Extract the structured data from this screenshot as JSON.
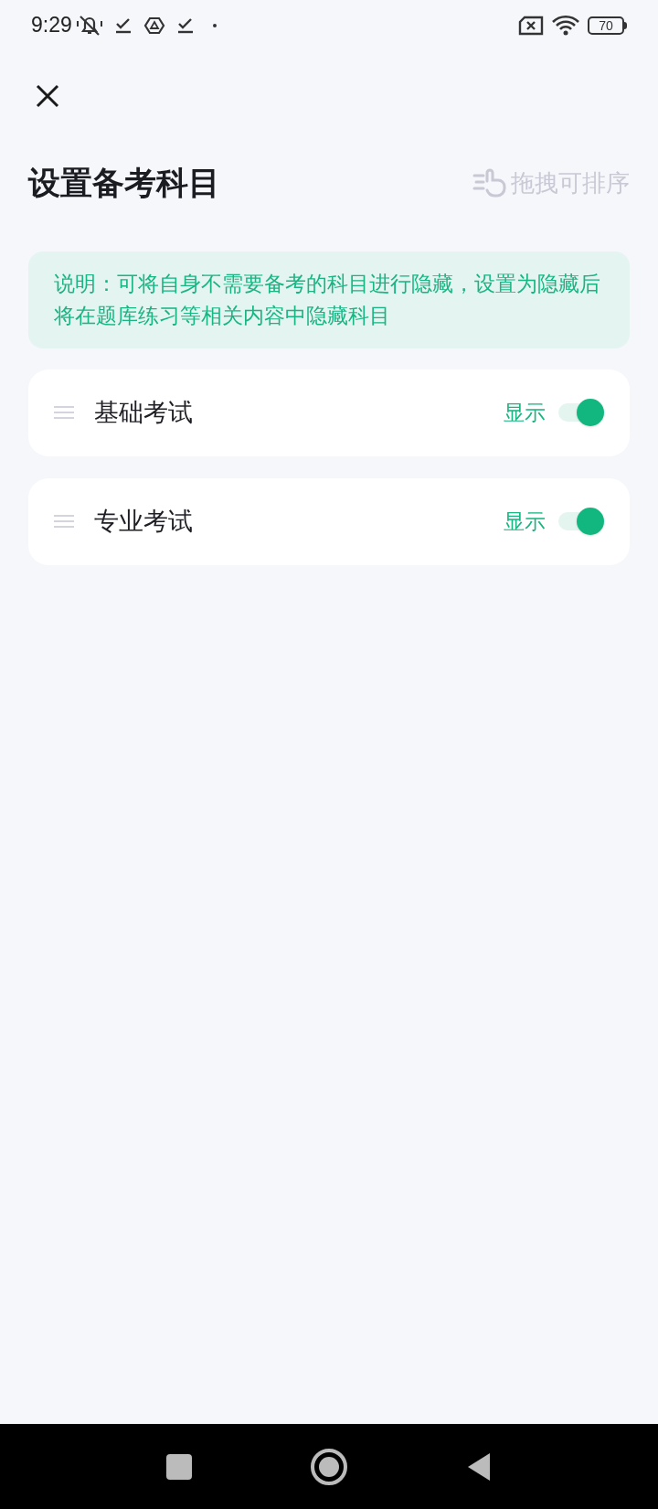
{
  "status_bar": {
    "time": "9:29",
    "battery": "70"
  },
  "title": "设置备考科目",
  "sort_hint": "拖拽可排序",
  "note": "说明：可将自身不需要备考的科目进行隐藏，设置为隐藏后将在题库练习等相关内容中隐藏科目",
  "subjects": [
    {
      "name": "基础考试",
      "visibility_label": "显示",
      "on": true
    },
    {
      "name": "专业考试",
      "visibility_label": "显示",
      "on": true
    }
  ]
}
